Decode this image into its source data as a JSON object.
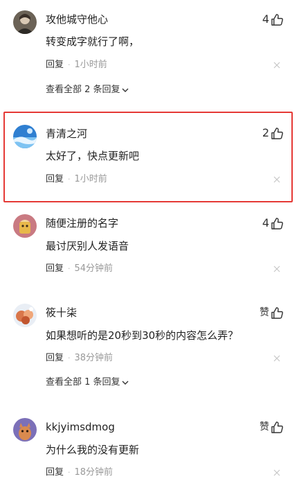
{
  "comments": [
    {
      "username": "攻他城守他心",
      "likes": "4",
      "content": "转变成字就行了啊，",
      "reply_label": "回复",
      "dot": "·",
      "time": "1小时前",
      "view_all": "查看全部 2 条回复"
    },
    {
      "username": "青清之河",
      "likes": "2",
      "content": "太好了，快点更新吧",
      "reply_label": "回复",
      "dot": "·",
      "time": "1小时前"
    },
    {
      "username": "随便注册的名字",
      "likes": "4",
      "content": "最讨厌别人发语音",
      "reply_label": "回复",
      "dot": "·",
      "time": "54分钟前"
    },
    {
      "username": "筱十柒",
      "likes": "赞",
      "content": "如果想听的是20秒到30秒的内容怎么弄？",
      "reply_label": "回复",
      "dot": "·",
      "time": "38分钟前",
      "view_all": "查看全部 1 条回复"
    },
    {
      "username": "kkjyimsdmog",
      "likes": "赞",
      "content": "为什么我的没有更新",
      "reply_label": "回复",
      "dot": "·",
      "time": "18分钟前"
    }
  ],
  "icons": {
    "like": "thumbs-up-icon",
    "close": "close-icon",
    "expand": "chevron-down-icon"
  },
  "colors": {
    "highlight": "#e53935",
    "text_primary": "#222222",
    "text_secondary": "#999999"
  }
}
